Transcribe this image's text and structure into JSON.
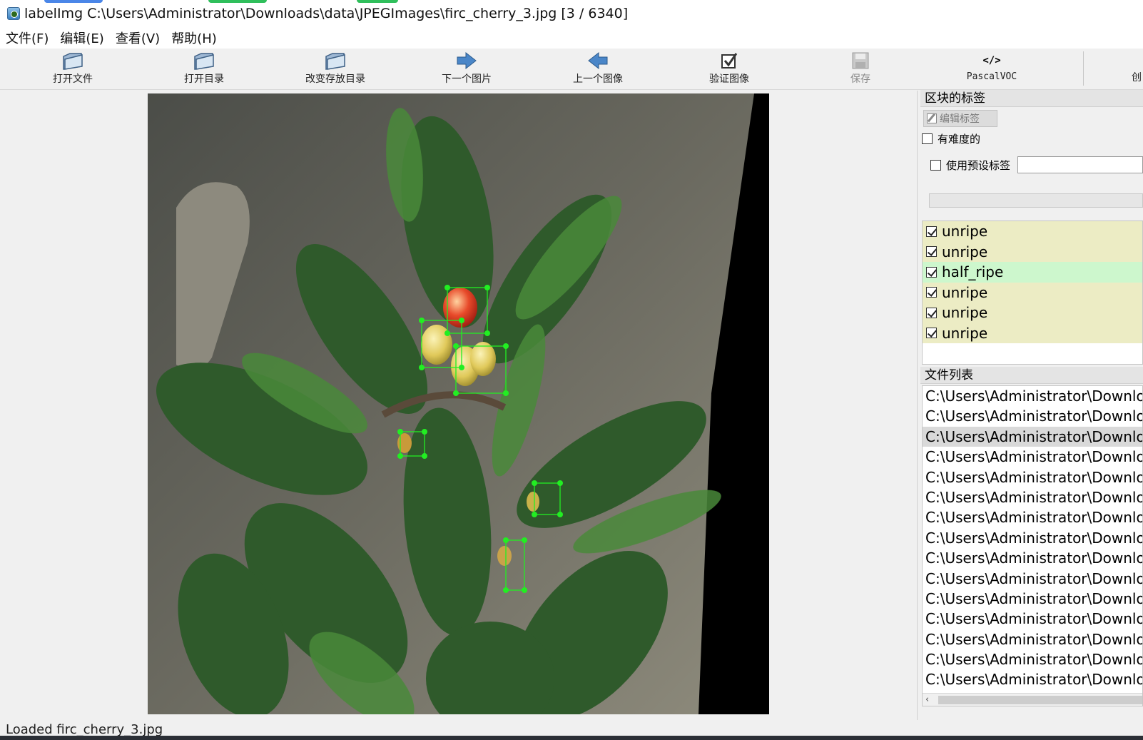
{
  "window": {
    "title": "labelImg C:\\Users\\Administrator\\Downloads\\data\\JPEGImages\\firc_cherry_3.jpg [3 / 6340]",
    "app_icon": "labelimg-app-icon"
  },
  "menu": [
    {
      "label": "文件(F)"
    },
    {
      "label": "编辑(E)"
    },
    {
      "label": "查看(V)"
    },
    {
      "label": "帮助(H)"
    }
  ],
  "toolbar": {
    "open_file": {
      "label": "打开文件",
      "icon": "folder-icon"
    },
    "open_dir": {
      "label": "打开目录",
      "icon": "folder-icon"
    },
    "change_save_dir": {
      "label": "改变存放目录",
      "icon": "folder-icon"
    },
    "next_image": {
      "label": "下一个图片",
      "icon": "arrow-right-icon"
    },
    "prev_image": {
      "label": "上一个图像",
      "icon": "arrow-left-icon"
    },
    "verify_image": {
      "label": "验证图像",
      "icon": "checkbox-icon"
    },
    "save": {
      "label": "保存",
      "icon": "save-icon",
      "disabled": true
    },
    "format": {
      "label": "PascalVOC",
      "icon": "code-icon"
    },
    "cut_off_label": "创"
  },
  "labels_panel": {
    "title": "区块的标签",
    "edit_label_button": "编辑标签",
    "difficult_label": "有难度的",
    "difficult_checked": false,
    "use_preset_label": "使用预设标签",
    "use_preset_checked": false,
    "preset_value": "",
    "items": [
      {
        "label": "unripe",
        "checked": true,
        "color": "#ececc4"
      },
      {
        "label": "unripe",
        "checked": true,
        "color": "#ececc4"
      },
      {
        "label": "half_ripe",
        "checked": true,
        "color": "#cdf7cd"
      },
      {
        "label": "unripe",
        "checked": true,
        "color": "#ececc4"
      },
      {
        "label": "unripe",
        "checked": true,
        "color": "#ececc4"
      },
      {
        "label": "unripe",
        "checked": true,
        "color": "#ececc4"
      }
    ]
  },
  "file_panel": {
    "title": "文件列表",
    "selected_index": 2,
    "items": [
      "C:\\Users\\Administrator\\Downloa",
      "C:\\Users\\Administrator\\Downloa",
      "C:\\Users\\Administrator\\Downloa",
      "C:\\Users\\Administrator\\Downloa",
      "C:\\Users\\Administrator\\Downloa",
      "C:\\Users\\Administrator\\Downloa",
      "C:\\Users\\Administrator\\Downloa",
      "C:\\Users\\Administrator\\Downloa",
      "C:\\Users\\Administrator\\Downloa",
      "C:\\Users\\Administrator\\Downloa",
      "C:\\Users\\Administrator\\Downloa",
      "C:\\Users\\Administrator\\Downloa",
      "C:\\Users\\Administrator\\Downloa",
      "C:\\Users\\Administrator\\Downloa",
      "C:\\Users\\Administrator\\Downloa"
    ]
  },
  "status": {
    "text": "Loaded firc_cherry_3.jpg"
  },
  "colors": {
    "box_stroke": "#22ee22",
    "unripe_row": "#ececc4",
    "half_ripe_row": "#cdf7cd"
  }
}
